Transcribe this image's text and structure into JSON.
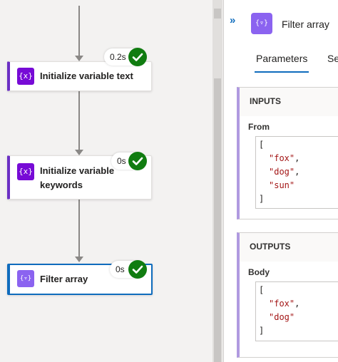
{
  "designer": {
    "steps": [
      {
        "icon": "{x}",
        "title": "Initialize variable text",
        "duration": "0.2s",
        "status": "success"
      },
      {
        "icon": "{x}",
        "title_line1": "Initialize variable",
        "title_line2": "keywords",
        "duration": "0s",
        "status": "success"
      },
      {
        "icon": "{▿}",
        "title": "Filter array",
        "duration": "0s",
        "status": "success",
        "selected": true
      }
    ]
  },
  "panel": {
    "collapse_glyph": "»",
    "icon": "{▿}",
    "title": "Filter array",
    "tabs": [
      "Parameters",
      "Se"
    ],
    "inputs": {
      "heading": "INPUTS",
      "field_label": "From",
      "open_bracket": "[",
      "close_bracket": "]",
      "items": [
        "\"fox\"",
        "\"dog\"",
        "\"sun\""
      ]
    },
    "outputs": {
      "heading": "OUTPUTS",
      "field_label": "Body",
      "open_bracket": "[",
      "close_bracket": "]",
      "items": [
        "\"fox\"",
        "\"dog\""
      ]
    }
  },
  "colors": {
    "success": "#107c10",
    "accent": "#0f6cbd",
    "variable_icon": "#770bd6",
    "filter_icon": "#8b63f0"
  }
}
